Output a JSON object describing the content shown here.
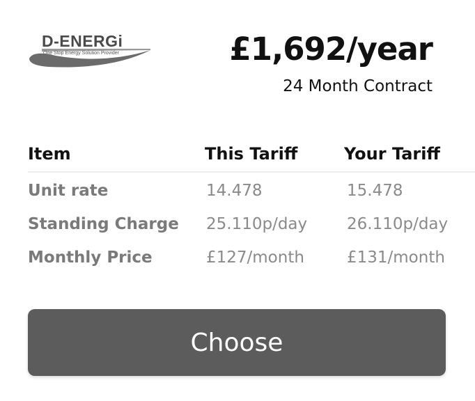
{
  "brand": {
    "name": "D-ENERGi",
    "tagline": "One Stop Energy Solution Provider"
  },
  "price": "£1,692/year",
  "contract": "24 Month Contract",
  "table": {
    "headers": [
      "Item",
      "This Tariff",
      "Your Tariff"
    ],
    "rows": [
      [
        "Unit rate",
        "14.478",
        "15.478"
      ],
      [
        "Standing Charge",
        "25.110p/day",
        "26.110p/day"
      ],
      [
        "Monthly Price",
        "£127/month",
        "£131/month"
      ]
    ]
  },
  "button": {
    "label": "Choose"
  }
}
